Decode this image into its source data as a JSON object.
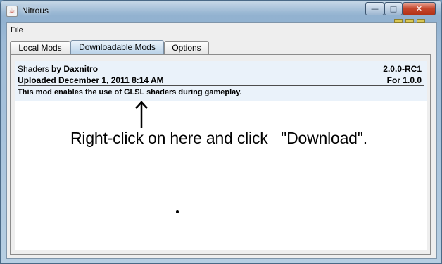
{
  "window": {
    "title": "Nitrous",
    "controls": {
      "minimize": "—",
      "maximize": "□",
      "close": "✕"
    }
  },
  "menu": {
    "file": "File"
  },
  "tabs": [
    {
      "label": "Local Mods",
      "active": false
    },
    {
      "label": "Downloadable Mods",
      "active": true
    },
    {
      "label": "Options",
      "active": false
    }
  ],
  "mod": {
    "name": "Shaders",
    "by_author": "by Daxnitro",
    "version": "2.0.0-RC1",
    "uploaded": "Uploaded December 1, 2011 8:14 AM",
    "for_version": "For 1.0.0",
    "description": "This mod enables the use of GLSL shaders during gameplay."
  },
  "annotation": {
    "text": "Right-click on here and click   \"Download\"."
  },
  "colors": {
    "selected_row": "#eaf2fa",
    "active_tab": "#b8d1e8",
    "close_button": "#c4452a"
  }
}
